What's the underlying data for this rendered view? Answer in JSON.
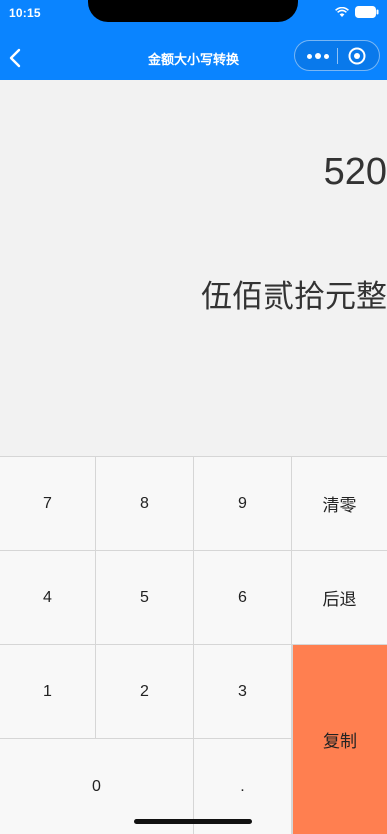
{
  "status_bar": {
    "time": "10:15",
    "icons": [
      "wifi-icon",
      "battery-icon"
    ]
  },
  "nav": {
    "title": "金额大小写转换",
    "back_icon": "chevron-left-icon",
    "capsule_icons": [
      "more-dots-icon",
      "close-target-icon"
    ],
    "bg_color": "#0a84ff"
  },
  "display": {
    "number": "520",
    "words": "伍佰贰拾元整"
  },
  "keypad": {
    "keys": {
      "k7": "7",
      "k8": "8",
      "k9": "9",
      "k4": "4",
      "k5": "5",
      "k6": "6",
      "k1": "1",
      "k2": "2",
      "k3": "3",
      "k0": "0",
      "dot": ".",
      "clear": "清零",
      "back": "后退",
      "copy": "复制"
    },
    "copy_color": "#ff7f50"
  }
}
